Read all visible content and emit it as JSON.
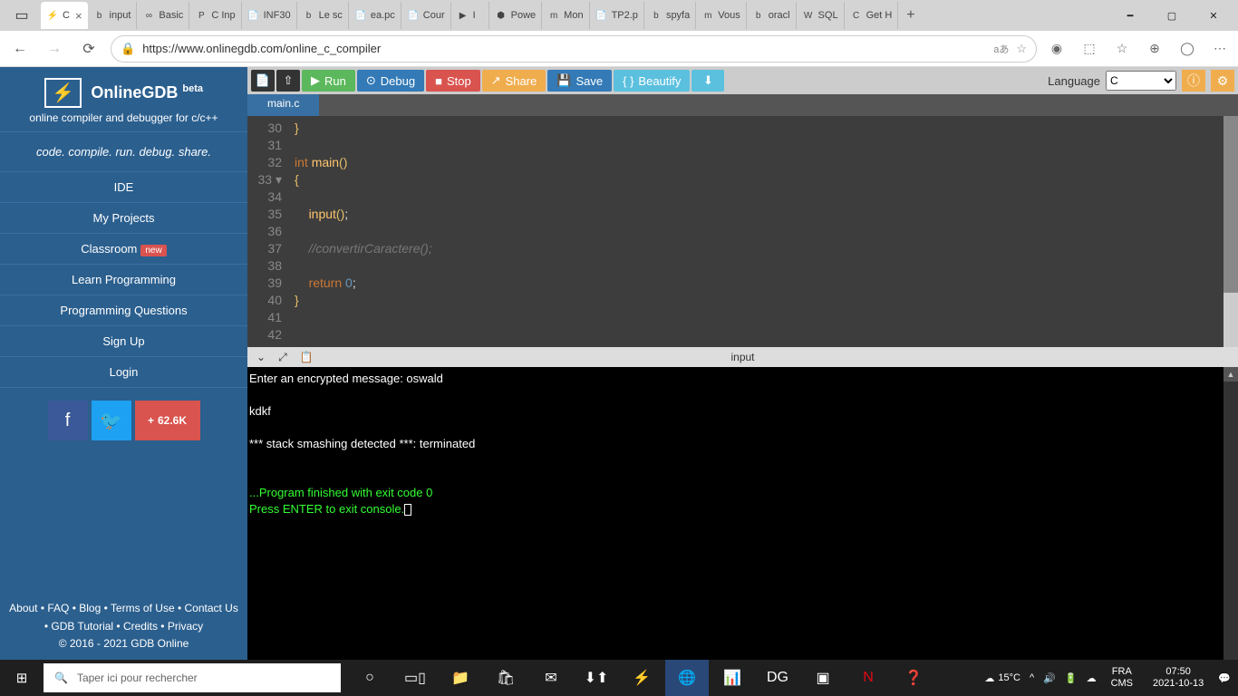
{
  "browser": {
    "tabs": [
      {
        "label": "C",
        "icon": "⚡",
        "active": true
      },
      {
        "label": "input",
        "icon": "b"
      },
      {
        "label": "Basic",
        "icon": "∞"
      },
      {
        "label": "C Inp",
        "icon": "P"
      },
      {
        "label": "INF30",
        "icon": "📄"
      },
      {
        "label": "Le sc",
        "icon": "b"
      },
      {
        "label": "ea.pc",
        "icon": "📄"
      },
      {
        "label": "Cour",
        "icon": "📄"
      },
      {
        "label": "I",
        "icon": "▶"
      },
      {
        "label": "Powe",
        "icon": "⬢"
      },
      {
        "label": "Mon",
        "icon": "m"
      },
      {
        "label": "TP2.p",
        "icon": "📄"
      },
      {
        "label": "spyfa",
        "icon": "b"
      },
      {
        "label": "Vous",
        "icon": "m"
      },
      {
        "label": "oracl",
        "icon": "b"
      },
      {
        "label": "SQL",
        "icon": "W"
      },
      {
        "label": "Get H",
        "icon": "C"
      }
    ],
    "url": "https://www.onlinegdb.com/online_c_compiler",
    "readerLabel": "aあ"
  },
  "sidebar": {
    "title": "OnlineGDB",
    "beta": "beta",
    "subtitle": "online compiler and debugger for c/c++",
    "motto": "code. compile. run. debug. share.",
    "items": [
      {
        "label": "IDE"
      },
      {
        "label": "My Projects"
      },
      {
        "label": "Classroom",
        "badge": "new"
      },
      {
        "label": "Learn Programming"
      },
      {
        "label": "Programming Questions"
      },
      {
        "label": "Sign Up"
      },
      {
        "label": "Login"
      }
    ],
    "shareCount": "62.6K",
    "footerLinks": "About  •  FAQ  •  Blog  •  Terms of Use  •  Contact Us",
    "footerLinks2": "•  GDB Tutorial  •  Credits  •  Privacy",
    "copyright": "© 2016 - 2021 GDB Online"
  },
  "toolbar": {
    "run": "Run",
    "debug": "Debug",
    "stop": "Stop",
    "share": "Share",
    "save": "Save",
    "beautify": "Beautify",
    "langLabel": "Language",
    "langValue": "C"
  },
  "editor": {
    "fileTab": "main.c",
    "lines": [
      {
        "num": "30",
        "html": "<span class='pn'>}</span>"
      },
      {
        "num": "31",
        "html": ""
      },
      {
        "num": "32",
        "html": "<span class='kw'>int</span> <span class='fn'>main</span><span class='pn'>()</span>"
      },
      {
        "num": "33",
        "html": "<span class='pn'>{</span>"
      },
      {
        "num": "34",
        "html": ""
      },
      {
        "num": "35",
        "html": "    <span class='fn'>input</span><span class='pn'>()</span>;"
      },
      {
        "num": "36",
        "html": ""
      },
      {
        "num": "37",
        "html": "    <span class='cm'>//convertirCaractere();</span>"
      },
      {
        "num": "38",
        "html": ""
      },
      {
        "num": "39",
        "html": "    <span class='kw'>return</span> <span class='num'>0</span>;"
      },
      {
        "num": "40",
        "html": "<span class='pn'>}</span>"
      },
      {
        "num": "41",
        "html": ""
      },
      {
        "num": "42",
        "html": ""
      }
    ]
  },
  "console": {
    "title": "input",
    "line1": "Enter an encrypted message: oswald",
    "line2": "",
    "line3": "kdkf",
    "line4": "",
    "line5": "*** stack smashing detected ***: terminated",
    "line6": "",
    "line7": "",
    "line8": "...Program finished with exit code 0",
    "line9": "Press ENTER to exit console."
  },
  "taskbar": {
    "searchPlaceholder": "Taper ici pour rechercher",
    "weather": "15°C",
    "lang1": "FRA",
    "lang2": "CMS",
    "time": "07:50",
    "date": "2021-10-13"
  }
}
